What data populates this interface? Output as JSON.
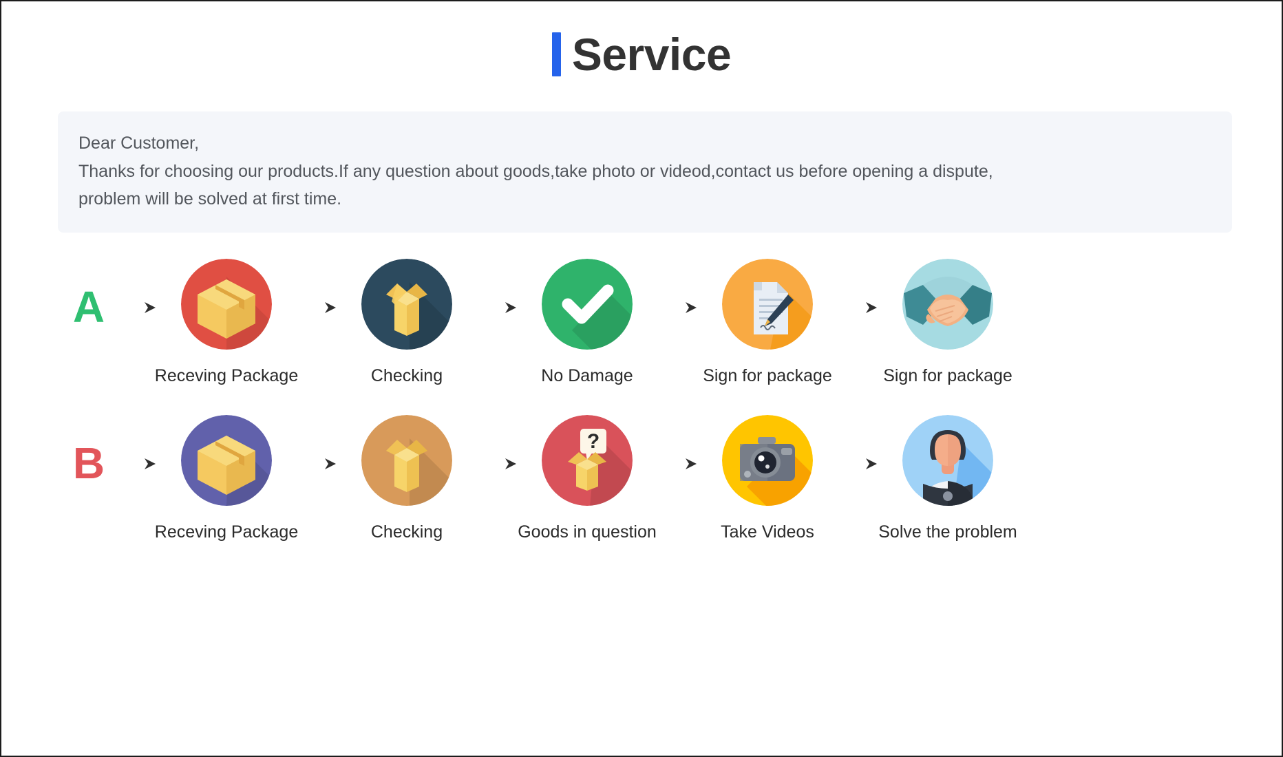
{
  "header": {
    "title": "Service",
    "accent_color": "#2563eb"
  },
  "notice": {
    "line1": "Dear Customer,",
    "line2": "Thanks for choosing our products.If any question about goods,take photo or videod,contact us before opening a dispute,",
    "line3": "problem will be solved at first time.",
    "background_color": "#f4f6fa"
  },
  "flows": [
    {
      "badge": "A",
      "badge_color": "#2fbf71",
      "steps": [
        {
          "label": "Receving Package",
          "icon": "closed-box-icon",
          "circle_color": "#e04f43"
        },
        {
          "label": "Checking",
          "icon": "open-box-icon",
          "circle_color": "#2c4a5e"
        },
        {
          "label": "No Damage",
          "icon": "check-mark-icon",
          "circle_color": "#2fb36b"
        },
        {
          "label": "Sign for package",
          "icon": "document-pen-icon",
          "circle_color": "#f9aa43"
        },
        {
          "label": "Sign for package",
          "icon": "handshake-icon",
          "circle_color": "#a6dbe2"
        }
      ]
    },
    {
      "badge": "B",
      "badge_color": "#e2555a",
      "steps": [
        {
          "label": "Receving Package",
          "icon": "closed-box-icon",
          "circle_color": "#6161ab"
        },
        {
          "label": "Checking",
          "icon": "open-box-icon",
          "circle_color": "#d89a5a"
        },
        {
          "label": "Goods in question",
          "icon": "question-box-icon",
          "circle_color": "#d9525a"
        },
        {
          "label": "Take Videos",
          "icon": "camera-icon",
          "circle_color": "#ffc500"
        },
        {
          "label": "Solve the problem",
          "icon": "support-agent-icon",
          "circle_color": "#9fd2f7"
        }
      ]
    }
  ],
  "arrow": {
    "name": "arrow-right-icon",
    "color": "#3c3c3c"
  }
}
